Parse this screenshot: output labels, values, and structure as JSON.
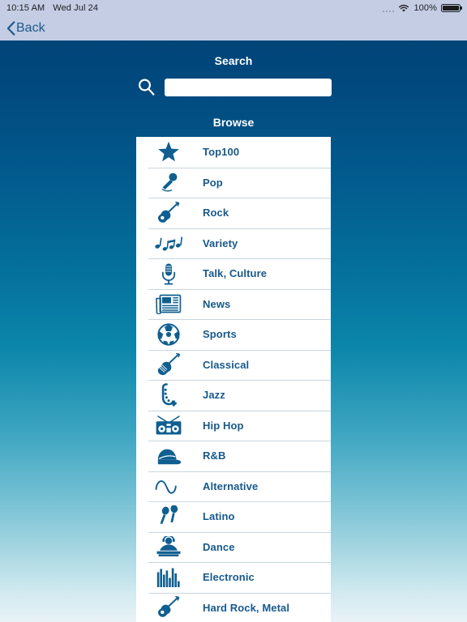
{
  "statusbar": {
    "time": "10:15 AM",
    "date": "Wed Jul 24",
    "battery_percent": "100%",
    "wifi_icon": "wifi-icon",
    "battery_icon": "battery-full-icon",
    "signal_icon": "signal-dots-icon"
  },
  "navbar": {
    "back_label": "Back",
    "back_icon": "chevron-left-icon"
  },
  "search": {
    "title": "Search",
    "icon": "search-icon",
    "value": "",
    "placeholder": ""
  },
  "browse": {
    "title": "Browse",
    "items": [
      {
        "label": "Top100",
        "icon": "star-icon"
      },
      {
        "label": "Pop",
        "icon": "handheld-microphone-icon"
      },
      {
        "label": "Rock",
        "icon": "electric-guitar-icon"
      },
      {
        "label": "Variety",
        "icon": "music-notes-icon"
      },
      {
        "label": "Talk, Culture",
        "icon": "studio-microphone-icon"
      },
      {
        "label": "News",
        "icon": "newspaper-icon"
      },
      {
        "label": "Sports",
        "icon": "soccer-ball-icon"
      },
      {
        "label": "Classical",
        "icon": "violin-icon"
      },
      {
        "label": "Jazz",
        "icon": "saxophone-icon"
      },
      {
        "label": "Hip Hop",
        "icon": "boombox-icon"
      },
      {
        "label": "R&B",
        "icon": "baseball-cap-icon"
      },
      {
        "label": "Alternative",
        "icon": "sine-wave-icon"
      },
      {
        "label": "Latino",
        "icon": "maracas-icon"
      },
      {
        "label": "Dance",
        "icon": "dj-turntable-icon"
      },
      {
        "label": "Electronic",
        "icon": "equalizer-bars-icon"
      },
      {
        "label": "Hard Rock, Metal",
        "icon": "electric-guitar-icon"
      }
    ]
  },
  "colors": {
    "statusbar_bg": "#c4cde4",
    "gradient_top": "#014478",
    "gradient_mid": "#0c86ab",
    "gradient_bottom": "#e9f3f7",
    "accent_blue": "#17598c",
    "icon_blue": "#0f5f90",
    "card_bg": "#ffffff"
  }
}
